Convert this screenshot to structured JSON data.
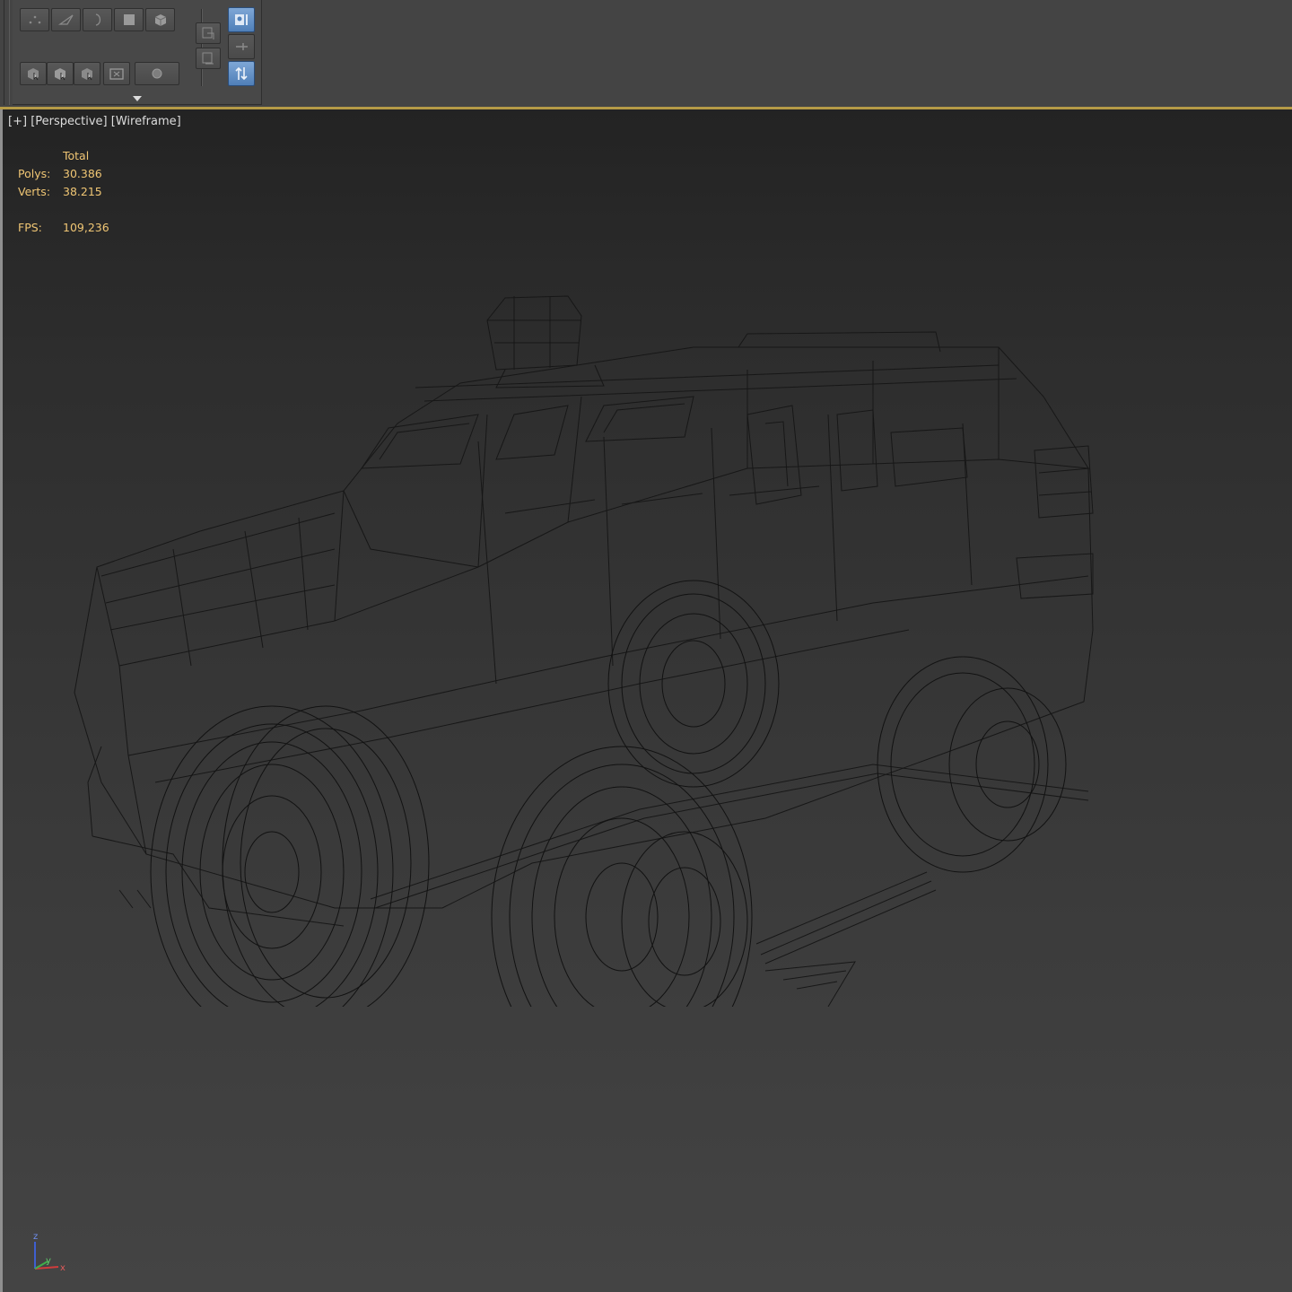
{
  "toolbar": {
    "row1_buttons": [
      "vertex-icon",
      "edge-icon",
      "border-icon",
      "polygon-icon",
      "element-icon"
    ],
    "row2_buttons": [
      "select-by-vertex-icon",
      "ignore-backfacing-icon",
      "by-angle-icon",
      "shrink-grow-icon",
      "ring-loop-icon"
    ],
    "side_buttons": [
      "named-selection-copy-icon",
      "named-selection-paste-icon"
    ],
    "toggle_buttons": [
      "show-end-result-icon",
      "pin-stack-icon",
      "make-unique-icon"
    ],
    "accent_color": "#b59a47",
    "active_button_color": "#5a88c2"
  },
  "viewport": {
    "plus_label": "[+]",
    "view_label": "[Perspective]",
    "shading_label": "[Wireframe]",
    "stats": {
      "total_header": "Total",
      "polys_label": "Polys:",
      "polys_value": "30.386",
      "verts_label": "Verts:",
      "verts_value": "38.215",
      "fps_label": "FPS:",
      "fps_value": "109,236",
      "text_color": "#f0c674"
    },
    "model_name": "armored-vehicle-wireframe",
    "axis_labels": {
      "z": "z",
      "y": "y",
      "x": "x"
    }
  }
}
